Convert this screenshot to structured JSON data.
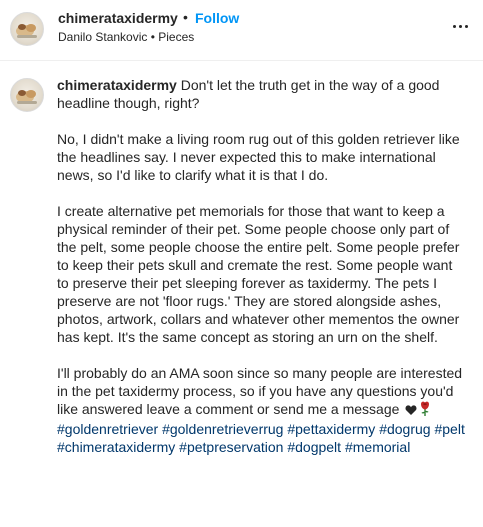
{
  "header": {
    "username": "chimerataxidermy",
    "separator": "•",
    "follow_label": "Follow",
    "subtitle": "Danilo Stankovic • Pieces"
  },
  "caption": {
    "username": "chimerataxidermy",
    "paragraph_1": "Don't let the truth get in the way of a good headline though, right?",
    "paragraph_2": "No, I didn't make a living room rug out of this golden retriever like the headlines say. I never expected this to make international news, so I'd like to clarify what it is that I do.",
    "paragraph_3": "I create alternative pet memorials for those that want to keep a physical reminder of their pet. Some people choose only part of the pelt, some people choose the entire pelt. Some people prefer to keep their pets skull and cremate the rest. Some people want to preserve their pet sleeping forever as taxidermy. The pets I preserve are not 'floor rugs.' They are stored alongside ashes, photos, artwork, collars and whatever other mementos the owner has kept. It's the same concept as storing an urn on the shelf.",
    "paragraph_4": "I'll probably do an AMA soon since so many people are interested in the pet taxidermy process, so if you have any questions you'd like answered leave a comment or send me a message",
    "paragraph_4_emojis": [
      "black-heart-icon",
      "rose-icon"
    ],
    "hashtags": [
      "#goldenretriever",
      "#goldenretrieverrug",
      "#pettaxidermy",
      "#dogrug",
      "#pelt",
      "#chimerataxidermy",
      "#petpreservation",
      "#dogpelt",
      "#memorial"
    ]
  },
  "colors": {
    "text": "#262626",
    "follow_blue": "#0095f6",
    "hashtag_blue": "#00376b",
    "divider": "#efefef"
  }
}
